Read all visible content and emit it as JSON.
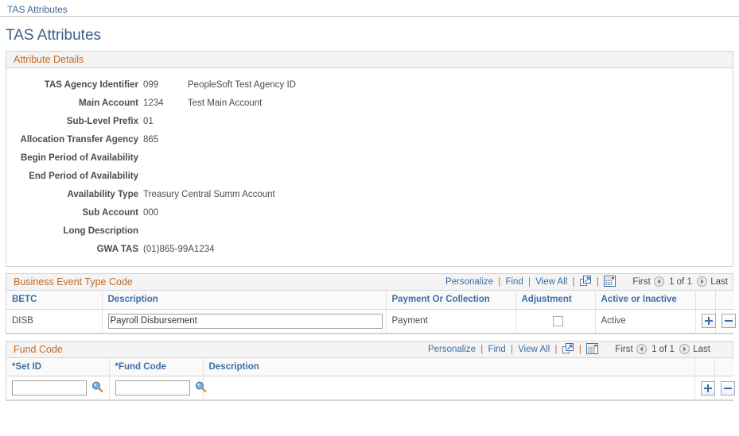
{
  "breadcrumb": {
    "label": "TAS Attributes"
  },
  "page": {
    "title": "TAS Attributes"
  },
  "attribute_details": {
    "section_title": "Attribute Details",
    "fields": [
      {
        "label": "TAS Agency Identifier",
        "value": "099",
        "description": "PeopleSoft Test Agency ID"
      },
      {
        "label": "Main Account",
        "value": "1234",
        "description": "Test Main Account"
      },
      {
        "label": "Sub-Level Prefix",
        "value": "01",
        "description": ""
      },
      {
        "label": "Allocation Transfer Agency",
        "value": "865",
        "description": ""
      },
      {
        "label": "Begin Period of Availability",
        "value": "",
        "description": ""
      },
      {
        "label": "End Period of Availability",
        "value": "",
        "description": ""
      },
      {
        "label": "Availability Type",
        "value": "Treasury Central Summ Account",
        "description": ""
      },
      {
        "label": "Sub Account",
        "value": "000",
        "description": ""
      },
      {
        "label": "Long Description",
        "value": "",
        "description": ""
      },
      {
        "label": "GWA TAS",
        "value": "(01)865-99A1234",
        "description": ""
      }
    ]
  },
  "toolbar": {
    "personalize": "Personalize",
    "find": "Find",
    "view_all": "View All",
    "separator": "|",
    "zoom_icon": "expand-grid-icon",
    "download_icon": "download-spreadsheet-icon",
    "first": "First",
    "last": "Last",
    "page_indicator": "1 of 1",
    "prev_icon": "previous-arrow-icon",
    "next_icon": "next-arrow-icon"
  },
  "business_event_type_code": {
    "section_title": "Business Event Type Code",
    "columns": [
      "BETC",
      "Description",
      "Payment Or Collection",
      "Adjustment",
      "Active or Inactive"
    ],
    "rows": [
      {
        "betc": "DISB",
        "description": "Payroll Disbursement",
        "payment_or_collection": "Payment",
        "adjustment_checked": false,
        "active_or_inactive": "Active",
        "add_label": "add-row-button",
        "delete_label": "delete-row-button"
      }
    ]
  },
  "fund_code": {
    "section_title": "Fund Code",
    "columns": [
      "*Set ID",
      "*Fund Code",
      "Description"
    ],
    "rows": [
      {
        "set_id": "",
        "fund_code": "",
        "description": "",
        "lookup_icon": "lookup-search-icon"
      }
    ]
  },
  "colors": {
    "accent_orange": "#c06a26",
    "link_blue": "#3b6ea5",
    "title_blue": "#3b5f87",
    "header_bg": "#f4f4f4",
    "border": "#d4d4d4"
  }
}
